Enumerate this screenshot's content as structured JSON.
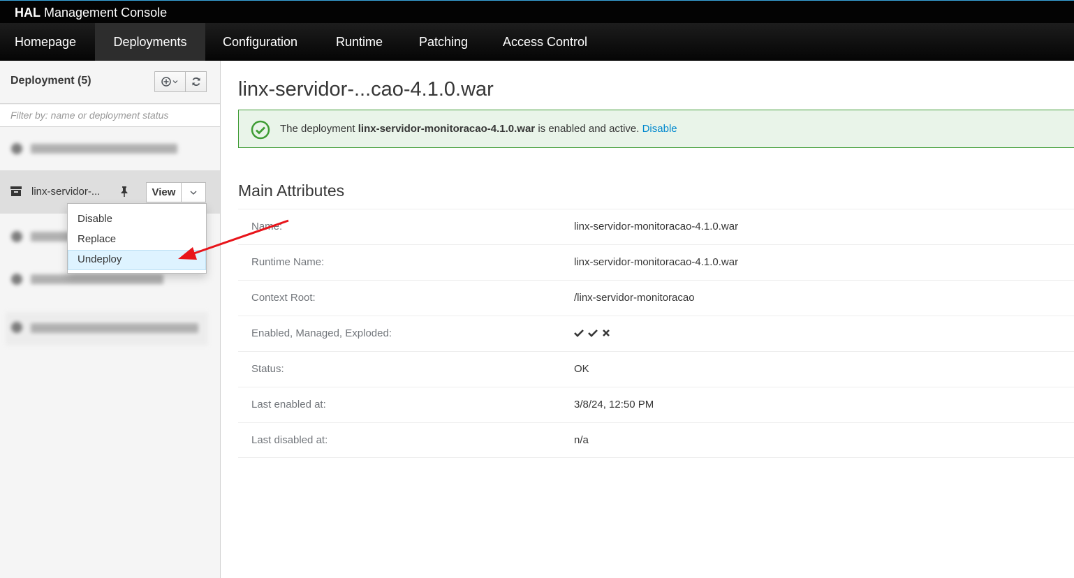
{
  "app": {
    "brand_bold": "HAL",
    "brand_rest": " Management Console"
  },
  "nav": {
    "items": [
      {
        "label": "Homepage"
      },
      {
        "label": "Deployments"
      },
      {
        "label": "Configuration"
      },
      {
        "label": "Runtime"
      },
      {
        "label": "Patching"
      },
      {
        "label": "Access Control"
      }
    ],
    "active": "Deployments"
  },
  "sidebar": {
    "title": "Deployment (5)",
    "filter_placeholder": "Filter by: name or deployment status",
    "selected_item": {
      "name": "linx-servidor-...",
      "view_label": "View"
    },
    "dropdown": {
      "items": [
        {
          "label": "Disable"
        },
        {
          "label": "Replace"
        },
        {
          "label": "Undeploy"
        }
      ],
      "highlighted": "Undeploy"
    }
  },
  "main": {
    "title": "linx-servidor-...cao-4.1.0.war",
    "alert": {
      "prefix": "The deployment ",
      "name": "linx-servidor-monitoracao-4.1.0.war",
      "suffix": " is enabled and active. ",
      "link": "Disable"
    },
    "section_title": "Main Attributes",
    "attributes": [
      {
        "label": "Name:",
        "value": "linx-servidor-monitoracao-4.1.0.war"
      },
      {
        "label": "Runtime Name:",
        "value": "linx-servidor-monitoracao-4.1.0.war"
      },
      {
        "label": "Context Root:",
        "value": "/linx-servidor-monitoracao"
      },
      {
        "label": "Enabled, Managed, Exploded:",
        "value": ""
      },
      {
        "label": "Status:",
        "value": "OK"
      },
      {
        "label": "Last enabled at:",
        "value": "3/8/24, 12:50 PM"
      },
      {
        "label": "Last disabled at:",
        "value": "n/a"
      }
    ],
    "flags": {
      "enabled": true,
      "managed": true,
      "exploded": false
    }
  },
  "colors": {
    "link": "#0088ce",
    "success": "#3f9c35",
    "annotation_arrow": "#e8141a"
  }
}
